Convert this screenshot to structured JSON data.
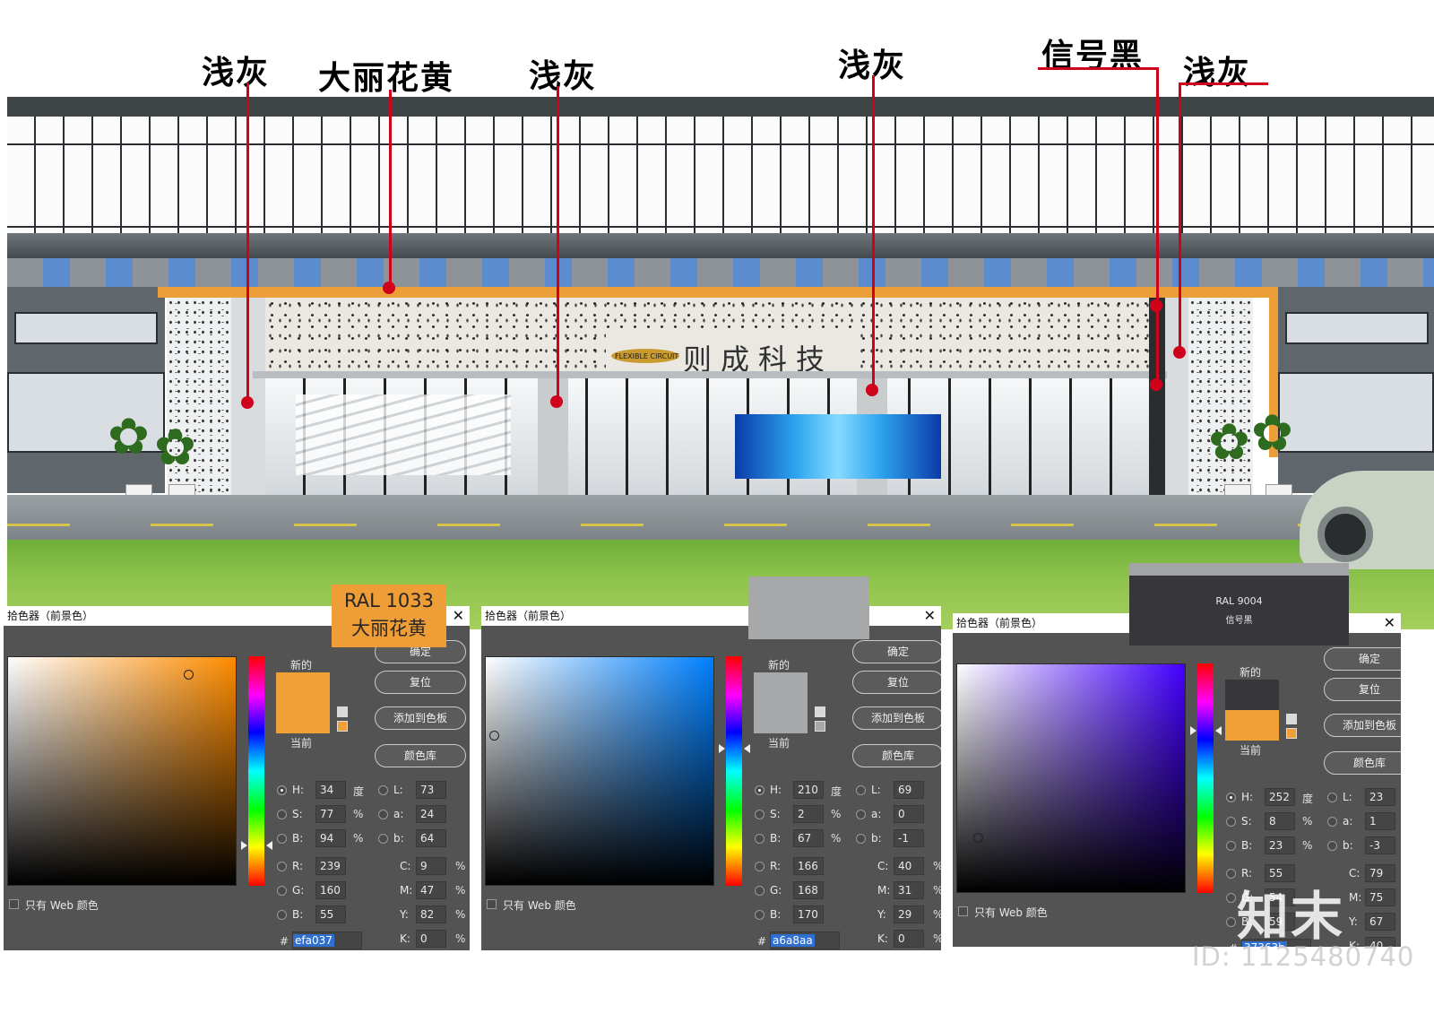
{
  "callouts": [
    {
      "label": "浅灰"
    },
    {
      "label": "大丽花黄"
    },
    {
      "label": "浅灰"
    },
    {
      "label": "浅灰"
    },
    {
      "label": "信号黑"
    },
    {
      "label": "浅灰"
    }
  ],
  "building": {
    "brand_name": "则成科技",
    "logo_text": "FLEXIBLE CIRCUIT"
  },
  "swatch_tags": {
    "ral1033_code": "RAL 1033",
    "ral1033_name": "大丽花黄",
    "ral9004_code": "RAL 9004",
    "ral9004_name": "信号黑"
  },
  "colors": {
    "dahlia_yellow": "#efa037",
    "light_grey": "#a6a8aa",
    "signal_black": "#37363b",
    "leader_red": "#d0021b"
  },
  "pickers": [
    {
      "title": "拾色器（前景色）",
      "new_label": "新的",
      "current_label": "当前",
      "new_color": "#efa037",
      "current_color": "#efa037",
      "field_hue_color": "#ff8c00",
      "buttons": [
        "确定",
        "复位",
        "添加到色板",
        "颜色库"
      ],
      "h": "34",
      "s": "77",
      "b": "94",
      "r": "239",
      "g": "160",
      "b_rgb": "55",
      "l": "73",
      "a": "24",
      "lab_b": "64",
      "c": "9",
      "m": "47",
      "y": "82",
      "k": "0",
      "hex": "efa037",
      "web_only": "只有 Web 颜色"
    },
    {
      "title": "拾色器（前景色）",
      "new_label": "新的",
      "current_label": "当前",
      "new_color": "#a6a8aa",
      "current_color": "#a6a8aa",
      "field_hue_color": "#0080ff",
      "buttons": [
        "确定",
        "复位",
        "添加到色板",
        "颜色库"
      ],
      "h": "210",
      "s": "2",
      "b": "67",
      "r": "166",
      "g": "168",
      "b_rgb": "170",
      "l": "69",
      "a": "0",
      "lab_b": "-1",
      "c": "40",
      "m": "31",
      "y": "29",
      "k": "0",
      "hex": "a6a8aa",
      "web_only": "只有 Web 颜色"
    },
    {
      "title": "拾色器（前景色）",
      "new_label": "新的",
      "current_label": "当前",
      "new_color": "#37363b",
      "current_color": "#efa037",
      "field_hue_color": "#4400ff",
      "buttons": [
        "确定",
        "复位",
        "添加到色板",
        "颜色库"
      ],
      "h": "252",
      "s": "8",
      "b": "23",
      "r": "55",
      "g": "54",
      "b_rgb": "59",
      "l": "23",
      "a": "1",
      "lab_b": "-3",
      "c": "79",
      "m": "75",
      "y": "67",
      "k": "40",
      "hex": "37363b",
      "web_only": "只有 Web 颜色"
    }
  ],
  "picker_labels": {
    "h": "H:",
    "s": "S:",
    "b": "B:",
    "r": "R:",
    "g": "G:",
    "bb": "B:",
    "l": "L:",
    "a": "a:",
    "lb": "b:",
    "c": "C:",
    "m": "M:",
    "y": "Y:",
    "k": "K:",
    "deg": "度",
    "pct": "%",
    "hash": "#"
  },
  "watermark": {
    "logo": "知末",
    "id": "ID: 1125480740"
  }
}
